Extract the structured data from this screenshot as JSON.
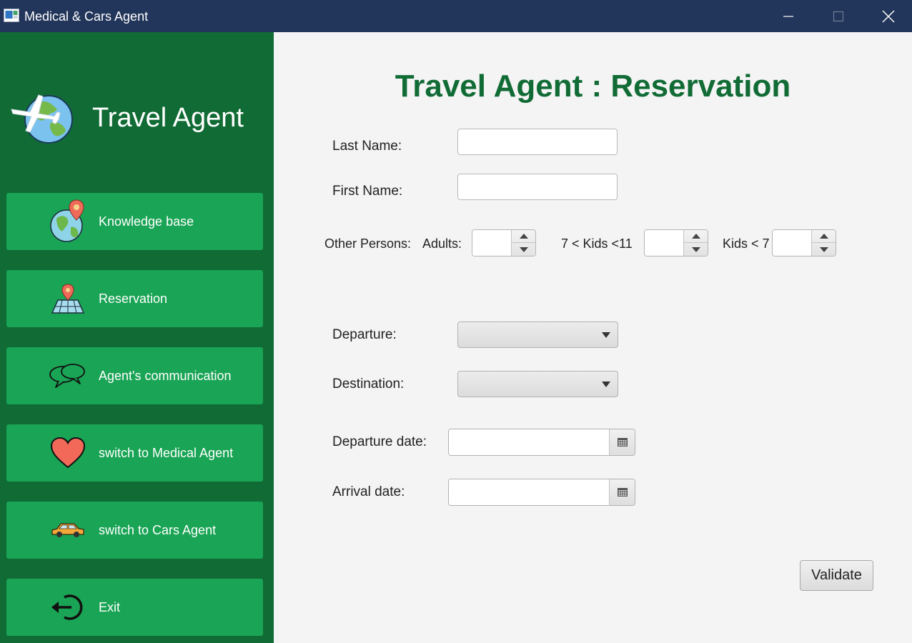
{
  "window": {
    "title": "Medical & Cars Agent",
    "controls": {
      "minimize": "minimize-icon",
      "maximize": "maximize-icon",
      "close": "close-icon"
    }
  },
  "sidebar": {
    "brand": "Travel Agent",
    "logo_icon": "airplane-globe-icon",
    "items": [
      {
        "label": "Knowledge base",
        "icon": "globe-pin-icon"
      },
      {
        "label": "Reservation",
        "icon": "map-pin-icon"
      },
      {
        "label": "Agent's communication",
        "icon": "chat-bubbles-icon"
      },
      {
        "label": "switch to Medical Agent",
        "icon": "heart-icon"
      },
      {
        "label": "switch to Cars Agent",
        "icon": "car-icon"
      },
      {
        "label": "Exit",
        "icon": "exit-icon"
      }
    ]
  },
  "form": {
    "title": "Travel Agent : Reservation",
    "last_name": {
      "label": "Last Name:",
      "value": ""
    },
    "first_name": {
      "label": "First Name:",
      "value": ""
    },
    "other_persons": {
      "label": "Other Persons:",
      "adults_label": "Adults:",
      "kids_mid_label": "7 < Kids <11",
      "kids_small_label": "Kids < 7",
      "adults_value": "",
      "kids_mid_value": "",
      "kids_small_value": ""
    },
    "departure": {
      "label": "Departure:",
      "selected": ""
    },
    "destination": {
      "label": "Destination:",
      "selected": ""
    },
    "departure_date": {
      "label": "Departure date:",
      "value": ""
    },
    "arrival_date": {
      "label": "Arrival date:",
      "value": ""
    },
    "validate_label": "Validate"
  },
  "colors": {
    "titlebar": "#22355a",
    "sidebar": "#116b35",
    "nav_button": "#1aa455",
    "title_text": "#116b35",
    "background": "#f4f4f4"
  }
}
